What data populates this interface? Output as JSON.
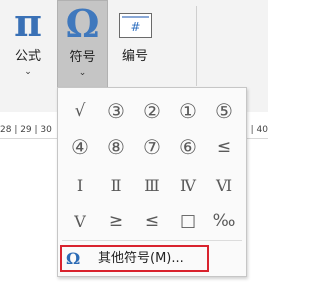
{
  "ribbon": {
    "formula": {
      "icon": "π",
      "label": "公式",
      "caret": "⌄"
    },
    "symbol": {
      "icon": "Ω",
      "label": "符号",
      "caret": "⌄"
    },
    "numbering": {
      "icon": "#",
      "label": "编号"
    }
  },
  "ruler": {
    "left_text": "28 | 29 | 30",
    "right_text": "| 40"
  },
  "symbols_menu": {
    "rows": [
      [
        "√",
        "③",
        "②",
        "①",
        "⑤"
      ],
      [
        "④",
        "⑧",
        "⑦",
        "⑥",
        "≤"
      ],
      [
        "Ⅰ",
        "Ⅱ",
        "Ⅲ",
        "Ⅳ",
        "Ⅵ"
      ],
      [
        "Ⅴ",
        "≥",
        "≤",
        "□",
        "‰"
      ]
    ],
    "more": {
      "icon": "Ω",
      "label": "其他符号(M)..."
    }
  }
}
